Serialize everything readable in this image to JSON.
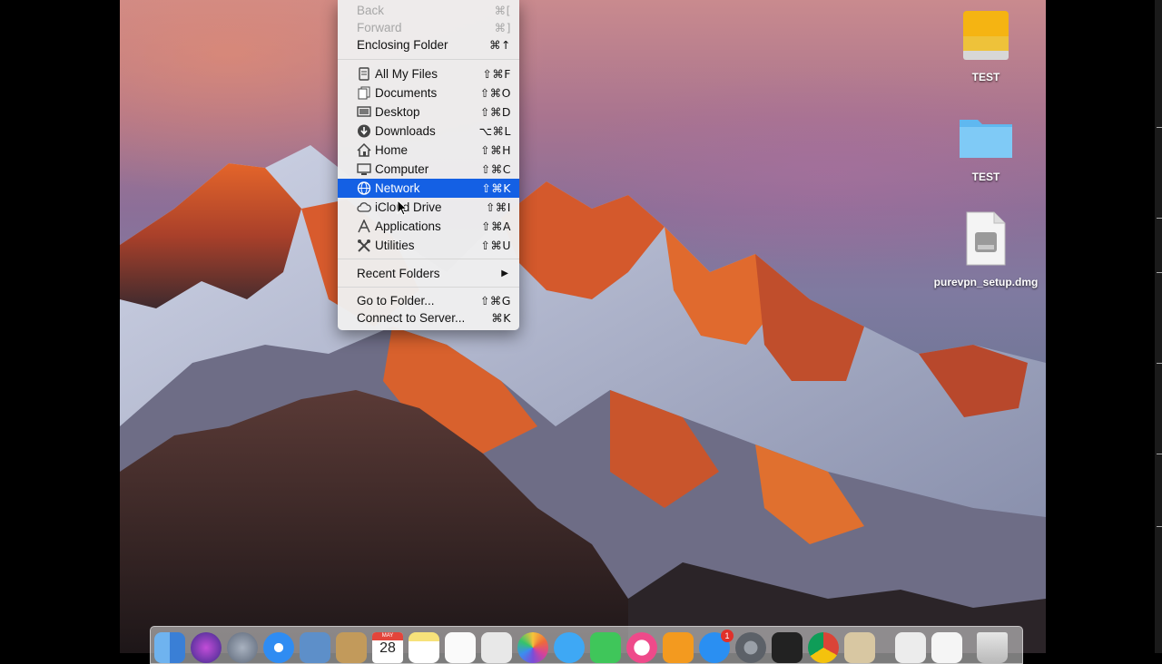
{
  "menu": {
    "items": [
      {
        "label": "Back",
        "shortcut": "⌘[",
        "disabled": true,
        "icon": ""
      },
      {
        "label": "Forward",
        "shortcut": "⌘]",
        "disabled": true,
        "icon": ""
      },
      {
        "label": "Enclosing Folder",
        "shortcut": "⌘↑",
        "disabled": false,
        "icon": ""
      },
      {
        "label": "All My Files",
        "shortcut": "⇧⌘F",
        "disabled": false,
        "icon": "all-files-icon"
      },
      {
        "label": "Documents",
        "shortcut": "⇧⌘O",
        "disabled": false,
        "icon": "documents-icon"
      },
      {
        "label": "Desktop",
        "shortcut": "⇧⌘D",
        "disabled": false,
        "icon": "desktop-icon"
      },
      {
        "label": "Downloads",
        "shortcut": "⌥⌘L",
        "disabled": false,
        "icon": "downloads-icon"
      },
      {
        "label": "Home",
        "shortcut": "⇧⌘H",
        "disabled": false,
        "icon": "home-icon"
      },
      {
        "label": "Computer",
        "shortcut": "⇧⌘C",
        "disabled": false,
        "icon": "computer-icon"
      },
      {
        "label": "Network",
        "shortcut": "⇧⌘K",
        "disabled": false,
        "icon": "network-icon",
        "highlighted": true
      },
      {
        "label": "iCloud Drive",
        "shortcut": "⇧⌘I",
        "disabled": false,
        "icon": "icloud-icon"
      },
      {
        "label": "Applications",
        "shortcut": "⇧⌘A",
        "disabled": false,
        "icon": "applications-icon"
      },
      {
        "label": "Utilities",
        "shortcut": "⇧⌘U",
        "disabled": false,
        "icon": "utilities-icon"
      },
      {
        "label": "Recent Folders",
        "shortcut": "",
        "disabled": false,
        "icon": "",
        "submenu": true
      },
      {
        "label": "Go to Folder...",
        "shortcut": "⇧⌘G",
        "disabled": false,
        "icon": ""
      },
      {
        "label": "Connect to Server...",
        "shortcut": "⌘K",
        "disabled": false,
        "icon": ""
      }
    ],
    "highlight_color": "#1460e4"
  },
  "desktop": {
    "icons": [
      {
        "label": "TEST",
        "icon": "drive-icon"
      },
      {
        "label": "TEST",
        "icon": "folder-icon"
      },
      {
        "label": "purevpn_setup.dmg",
        "icon": "dmg-file-icon"
      }
    ]
  },
  "dock": {
    "calendar_month": "MAY",
    "calendar_day": "28",
    "app_store_badge": "1",
    "icons": [
      "finder-icon",
      "siri-icon",
      "launchpad-icon",
      "safari-icon",
      "preview-icon",
      "contacts-icon",
      "calendar-icon",
      "notes-icon",
      "reminders-icon",
      "photo-booth-icon",
      "photos-icon",
      "messages-icon",
      "facetime-icon",
      "itunes-icon",
      "ibooks-icon",
      "app-store-icon",
      "system-preferences-icon",
      "activity-monitor-icon",
      "chrome-icon",
      "setup-assistant-icon",
      "downloads-stack-icon",
      "documents-stack-icon",
      "trash-icon"
    ]
  }
}
